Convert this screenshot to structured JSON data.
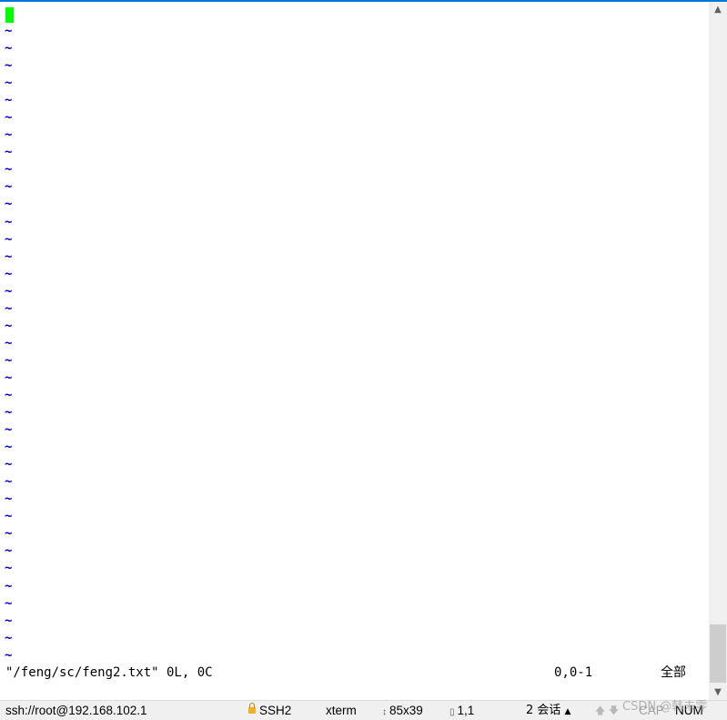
{
  "vim": {
    "empty_line_marker": "~",
    "file_info": "\"/feng/sc/feng2.txt\" 0L, 0C",
    "cursor_position": "0,0-1",
    "scroll_position": "全部"
  },
  "status_bar": {
    "connection": "ssh://root@192.168.102.1",
    "protocol": "SSH2",
    "terminal_type": "xterm",
    "size": "85x39",
    "position": "1,1",
    "sessions": "2 会话",
    "cap": "CAP",
    "num": "NUM"
  },
  "watermark": "CSDN @韩未零",
  "colors": {
    "cursor": "#00ff00",
    "tilde": "#0000c8",
    "accent": "#0078d7"
  }
}
